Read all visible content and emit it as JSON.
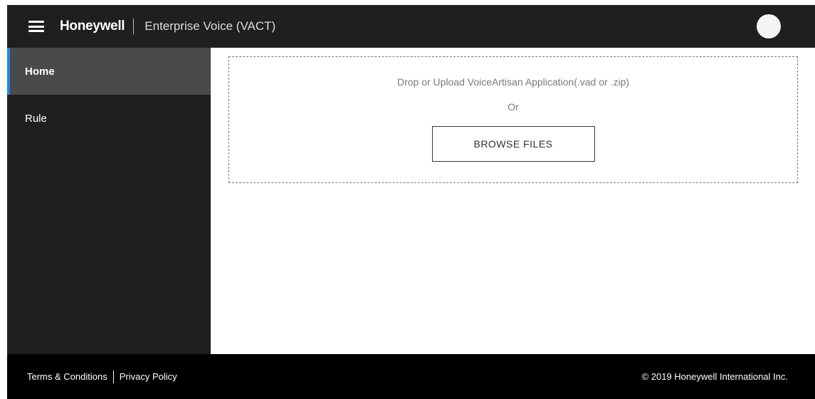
{
  "header": {
    "brand": "Honeywell",
    "app_title": "Enterprise Voice (VACT)"
  },
  "sidebar": {
    "items": [
      {
        "label": "Home",
        "active": true
      },
      {
        "label": "Rule",
        "active": false
      }
    ]
  },
  "upload": {
    "prompt": "Drop or Upload VoiceArtisan Application(.vad or .zip)",
    "or": "Or",
    "browse_label": "BROWSE FILES"
  },
  "footer": {
    "terms": "Terms & Conditions",
    "privacy": "Privacy Policy",
    "copyright": "© 2019 Honeywell International Inc."
  },
  "colors": {
    "header_bg": "#1f1f1f",
    "sidebar_active_bg": "#4a4a4a",
    "accent": "#1e88e5",
    "footer_bg": "#000000"
  },
  "icons": [
    "hamburger-menu-icon",
    "avatar"
  ]
}
